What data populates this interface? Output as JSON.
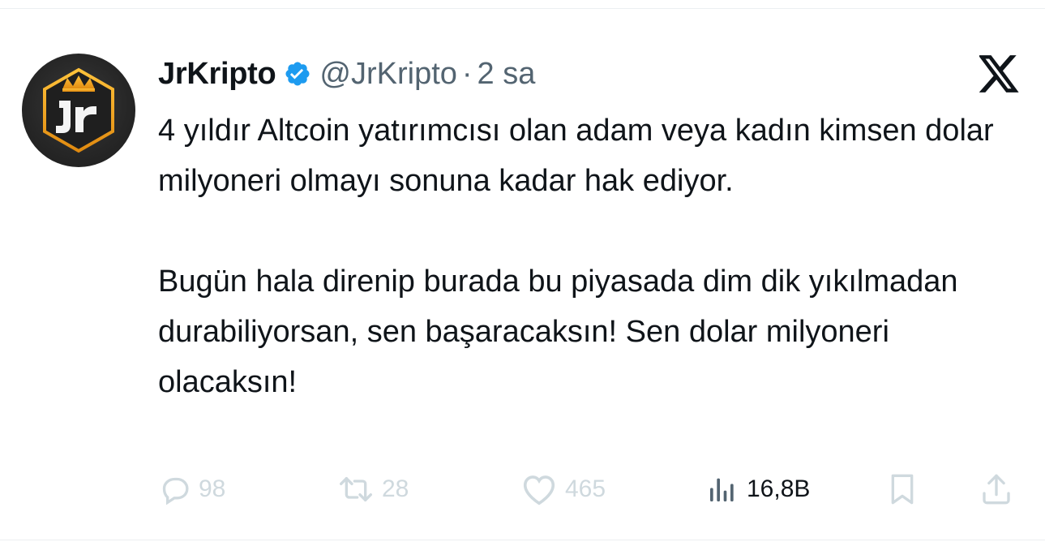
{
  "tweet": {
    "display_name": "JrKripto",
    "handle": "@JrKripto",
    "separator": "·",
    "time": "2 sa",
    "verified": true,
    "avatar_icon": "jr-crown-logo-icon",
    "platform_icon": "x-logo-icon",
    "paragraphs": [
      "4 yıldır Altcoin yatırımcısı olan adam veya kadın kimsen dolar milyoneri olmayı sonuna kadar hak ediyor.",
      "Bugün hala direnip burada bu piyasada dim dik yıkılmadan durabiliyorsan, sen başaracaksın! Sen dolar milyoneri olacaksın!"
    ]
  },
  "actions": {
    "replies": "98",
    "retweets": "28",
    "likes": "465",
    "views": "16,8B"
  },
  "colors": {
    "text": "#0f1419",
    "secondary": "#536471",
    "muted_actions": "#cfd9de",
    "verified_blue": "#1d9bf0",
    "avatar_gold": "#f0a020"
  }
}
